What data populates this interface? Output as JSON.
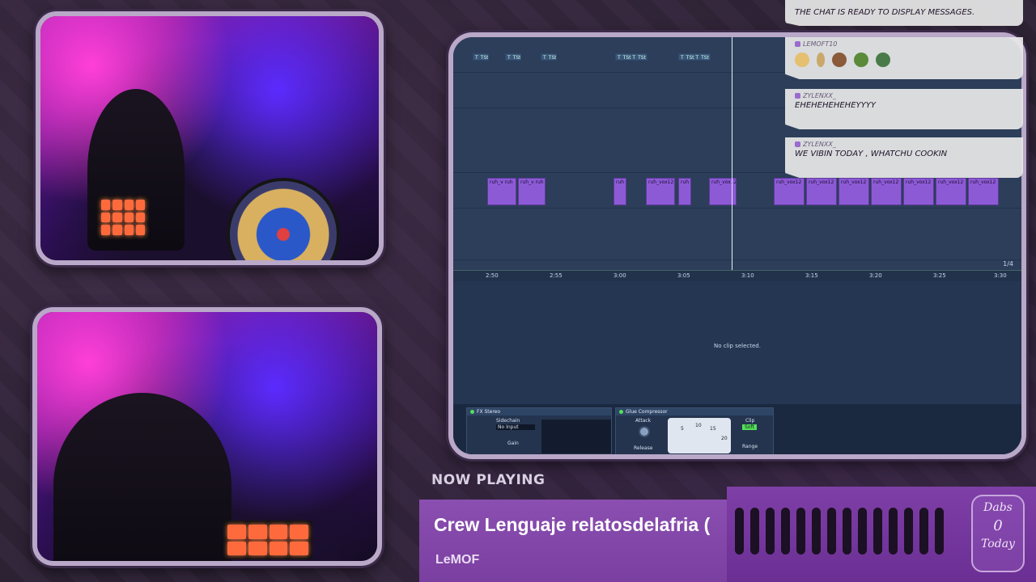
{
  "chat": {
    "messages": [
      {
        "user": "",
        "text": "THE CHAT IS READY TO DISPLAY MESSAGES."
      },
      {
        "user": "LEMOFT10",
        "text": ""
      },
      {
        "user": "ZYLENXX_",
        "text": "EHEHEHEHEHEYYYY"
      },
      {
        "user": "ZYLENXX_",
        "text": "WE VIBIN TODAY , WHATCHU COOKIN"
      }
    ]
  },
  "daw": {
    "clip_labels": {
      "top": [
        "T_TSt",
        "T_TSt",
        "T_TSt",
        "T_TSt T_TSt",
        "T_TSt T_TSt"
      ],
      "vox_a": [
        "ruh_v ruh",
        "ruh_v ruh"
      ],
      "vox_b": [
        "ruh",
        "ruh_vox12",
        "ruh",
        "ruh_vox12"
      ],
      "vox_c": [
        "ruh_vox12",
        "ruh_vox12",
        "ruh_vox12",
        "ruh_vox12",
        "ruh_vox12",
        "ruh_vox12",
        "ruh_vox12"
      ]
    },
    "ruler": [
      "2:50",
      "2:55",
      "3:00",
      "3:05",
      "3:10",
      "3:15",
      "3:20",
      "3:25",
      "3:30"
    ],
    "quantize": "1/4",
    "detail_message": "No clip selected.",
    "devices": {
      "fx_stereo": {
        "title": "FX Stereo",
        "sidechain": "Sidechain",
        "input": "No Input",
        "gain": "Gain"
      },
      "glue": {
        "title": "Glue Compressor",
        "attack": "Attack",
        "release": "Release",
        "clip": "Clip",
        "soft": "Soft",
        "range": "Range",
        "scale": [
          "5",
          "10",
          "15",
          "20"
        ]
      }
    }
  },
  "now_playing": {
    "label": "NOW PLAYING",
    "track": "Crew Lenguaje relatosdelafria (",
    "artist": "LeMOF"
  },
  "dabs": {
    "title_top": "Dabs",
    "count": "0",
    "title_bottom": "Today"
  },
  "colors": {
    "frame": "#b9a8c8",
    "clip": "#8d5ad6",
    "chat_bg": "#e8e8e8",
    "np_bar": "#8a4fb0",
    "pad": "#ff6a3d"
  }
}
